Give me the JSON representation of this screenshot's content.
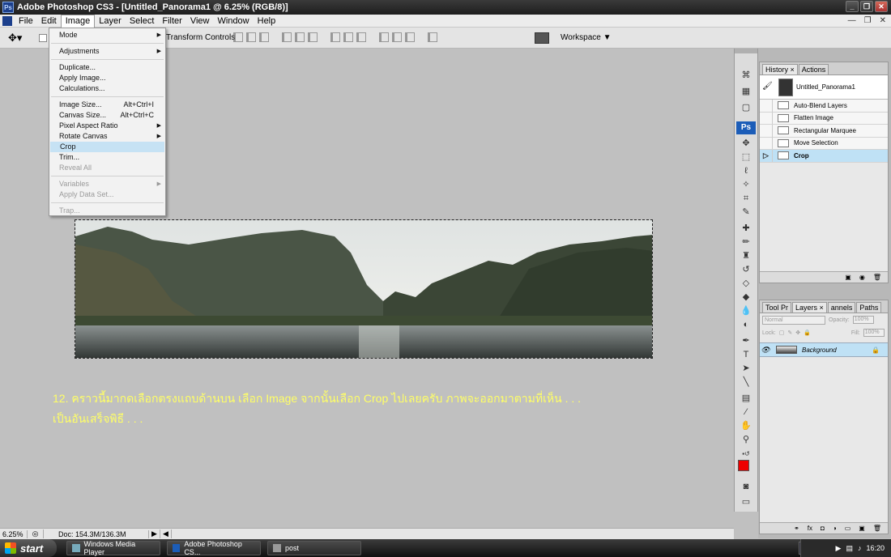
{
  "window": {
    "title": "Adobe Photoshop CS3 - [Untitled_Panorama1 @ 6.25% (RGB/8)]",
    "ps_logo": "Ps"
  },
  "menubar": [
    "File",
    "Edit",
    "Image",
    "Layer",
    "Select",
    "Filter",
    "View",
    "Window",
    "Help"
  ],
  "options": {
    "transform_label": "Transform Controls",
    "workspace_label": "Workspace ▼"
  },
  "image_menu": [
    {
      "label": "Mode",
      "submenu": true
    },
    {
      "sep": true
    },
    {
      "label": "Adjustments",
      "submenu": true
    },
    {
      "sep": true
    },
    {
      "label": "Duplicate..."
    },
    {
      "label": "Apply Image..."
    },
    {
      "label": "Calculations..."
    },
    {
      "sep": true
    },
    {
      "label": "Image Size...",
      "shortcut": "Alt+Ctrl+I"
    },
    {
      "label": "Canvas Size...",
      "shortcut": "Alt+Ctrl+C"
    },
    {
      "label": "Pixel Aspect Ratio",
      "submenu": true
    },
    {
      "label": "Rotate Canvas",
      "submenu": true
    },
    {
      "label": "Crop",
      "selected": true
    },
    {
      "label": "Trim..."
    },
    {
      "label": "Reveal All",
      "disabled": true
    },
    {
      "sep": true
    },
    {
      "label": "Variables",
      "submenu": true,
      "disabled": true
    },
    {
      "label": "Apply Data Set...",
      "disabled": true
    },
    {
      "sep": true
    },
    {
      "label": "Trap...",
      "disabled": true
    }
  ],
  "instruction": {
    "line1": "12. คราวนี้มากดเลือกตรงแถบด้านบน เลือก Image จากนั้นเลือก Crop ไปเลยครับ ภาพจะออกมาตามที่เห็น . . .",
    "line2": "เป็นอันเสร็จพิธี . . ."
  },
  "status": {
    "zoom": "6.25%",
    "doc": "Doc: 154.3M/136.3M"
  },
  "tools_badge": "Ps",
  "history_panel": {
    "tabs": [
      "History ×",
      "Actions"
    ],
    "snapshot": "Untitled_Panorama1",
    "steps": [
      {
        "label": "Auto-Blend Layers",
        "current": false
      },
      {
        "label": "Flatten Image",
        "current": false
      },
      {
        "label": "Rectangular Marquee",
        "current": false
      },
      {
        "label": "Move Selection",
        "current": false
      },
      {
        "label": "Crop",
        "current": true
      }
    ]
  },
  "layers_panel": {
    "tabs": [
      "Tool Pr",
      "Layers ×",
      "annels",
      "Paths"
    ],
    "blend_mode": "Normal",
    "opacity_label": "Opacity:",
    "opacity": "100%",
    "lock_label": "Lock:",
    "fill_label": "Fill:",
    "fill": "100%",
    "layer_name": "Background"
  },
  "taskbar": {
    "start": "start",
    "tasks": [
      "Windows Media Player",
      "Adobe Photoshop CS...",
      "post"
    ],
    "lang": "TH",
    "clock": "16:20"
  }
}
